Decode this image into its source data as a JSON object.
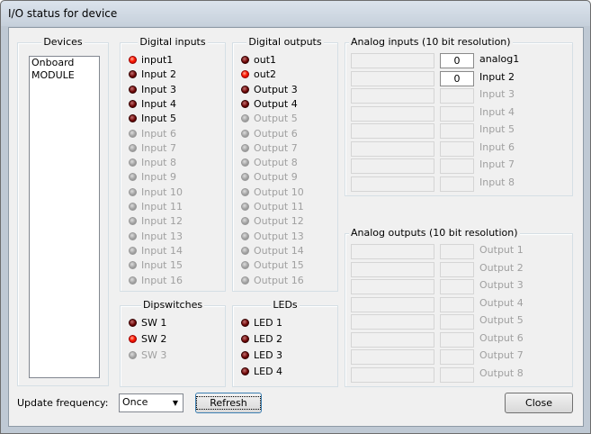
{
  "window": {
    "title": "I/O status for device"
  },
  "devices": {
    "title": "Devices",
    "items": [
      "Onboard",
      "MODULE"
    ]
  },
  "digital_inputs": {
    "title": "Digital inputs",
    "items": [
      {
        "label": "input1",
        "state": "on"
      },
      {
        "label": "Input 2",
        "state": "off"
      },
      {
        "label": "Input 3",
        "state": "off"
      },
      {
        "label": "Input 4",
        "state": "off"
      },
      {
        "label": "Input 5",
        "state": "off"
      },
      {
        "label": "Input 6",
        "state": "disabled"
      },
      {
        "label": "Input 7",
        "state": "disabled"
      },
      {
        "label": "Input 8",
        "state": "disabled"
      },
      {
        "label": "Input 9",
        "state": "disabled"
      },
      {
        "label": "Input 10",
        "state": "disabled"
      },
      {
        "label": "Input 11",
        "state": "disabled"
      },
      {
        "label": "Input 12",
        "state": "disabled"
      },
      {
        "label": "Input 13",
        "state": "disabled"
      },
      {
        "label": "Input 14",
        "state": "disabled"
      },
      {
        "label": "Input 15",
        "state": "disabled"
      },
      {
        "label": "Input 16",
        "state": "disabled"
      }
    ]
  },
  "digital_outputs": {
    "title": "Digital outputs",
    "items": [
      {
        "label": "out1",
        "state": "off"
      },
      {
        "label": "out2",
        "state": "on"
      },
      {
        "label": "Output 3",
        "state": "off"
      },
      {
        "label": "Output 4",
        "state": "off"
      },
      {
        "label": "Output 5",
        "state": "disabled"
      },
      {
        "label": "Output 6",
        "state": "disabled"
      },
      {
        "label": "Output 7",
        "state": "disabled"
      },
      {
        "label": "Output 8",
        "state": "disabled"
      },
      {
        "label": "Output 9",
        "state": "disabled"
      },
      {
        "label": "Output 10",
        "state": "disabled"
      },
      {
        "label": "Output 11",
        "state": "disabled"
      },
      {
        "label": "Output 12",
        "state": "disabled"
      },
      {
        "label": "Output 13",
        "state": "disabled"
      },
      {
        "label": "Output 14",
        "state": "disabled"
      },
      {
        "label": "Output 15",
        "state": "disabled"
      },
      {
        "label": "Output 16",
        "state": "disabled"
      }
    ]
  },
  "dipswitches": {
    "title": "Dipswitches",
    "items": [
      {
        "label": "SW 1",
        "state": "off"
      },
      {
        "label": "SW 2",
        "state": "on"
      },
      {
        "label": "SW 3",
        "state": "disabled"
      }
    ]
  },
  "leds": {
    "title": "LEDs",
    "items": [
      {
        "label": "LED 1",
        "state": "off"
      },
      {
        "label": "LED 2",
        "state": "off"
      },
      {
        "label": "LED 3",
        "state": "off"
      },
      {
        "label": "LED 4",
        "state": "off"
      }
    ]
  },
  "analog_inputs": {
    "title": "Analog inputs (10 bit resolution)",
    "items": [
      {
        "label": "analog1",
        "value": "0",
        "enabled": true
      },
      {
        "label": "Input 2",
        "value": "0",
        "enabled": true
      },
      {
        "label": "Input 3",
        "value": "",
        "enabled": false
      },
      {
        "label": "Input 4",
        "value": "",
        "enabled": false
      },
      {
        "label": "Input 5",
        "value": "",
        "enabled": false
      },
      {
        "label": "Input 6",
        "value": "",
        "enabled": false
      },
      {
        "label": "Input 7",
        "value": "",
        "enabled": false
      },
      {
        "label": "Input 8",
        "value": "",
        "enabled": false
      }
    ]
  },
  "analog_outputs": {
    "title": "Analog outputs (10 bit resolution)",
    "items": [
      {
        "label": "Output 1",
        "value": "",
        "enabled": false
      },
      {
        "label": "Output 2",
        "value": "",
        "enabled": false
      },
      {
        "label": "Output 3",
        "value": "",
        "enabled": false
      },
      {
        "label": "Output 4",
        "value": "",
        "enabled": false
      },
      {
        "label": "Output 5",
        "value": "",
        "enabled": false
      },
      {
        "label": "Output 6",
        "value": "",
        "enabled": false
      },
      {
        "label": "Output 7",
        "value": "",
        "enabled": false
      },
      {
        "label": "Output 8",
        "value": "",
        "enabled": false
      }
    ]
  },
  "footer": {
    "update_label": "Update frequency:",
    "update_value": "Once",
    "refresh_label": "Refresh",
    "close_label": "Close"
  }
}
